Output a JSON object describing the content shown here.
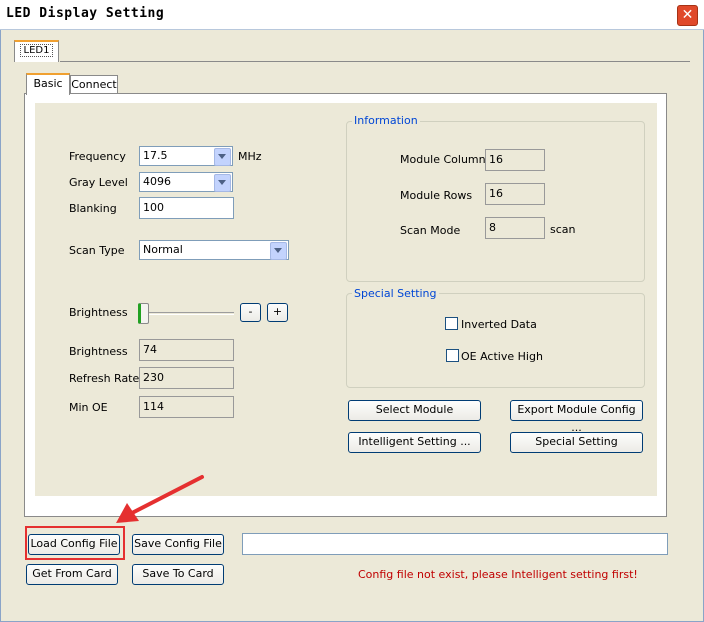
{
  "window": {
    "title": "LED Display Setting",
    "close_label": "✕"
  },
  "outer_tabs": [
    {
      "label": "LED1"
    }
  ],
  "inner_tabs": [
    {
      "label": "Basic"
    },
    {
      "label": "Connect"
    }
  ],
  "basic": {
    "frequency": {
      "label": "Frequency",
      "value": "17.5",
      "unit": "MHz"
    },
    "gray_level": {
      "label": "Gray Level",
      "value": "4096"
    },
    "blanking": {
      "label": "Blanking",
      "value": "100"
    },
    "scan_type": {
      "label": "Scan Type",
      "value": "Normal"
    },
    "brightness_slider": {
      "label": "Brightness",
      "level": 0,
      "minus_label": "-",
      "plus_label": "+"
    },
    "brightness": {
      "label": "Brightness",
      "value": "74"
    },
    "refresh_rate": {
      "label": "Refresh Rate",
      "value": "230"
    },
    "min_oe": {
      "label": "Min OE",
      "value": "114"
    }
  },
  "information": {
    "title": "Information",
    "module_columns": {
      "label": "Module Columns",
      "value": "16"
    },
    "module_rows": {
      "label": "Module Rows",
      "value": "16"
    },
    "scan_mode": {
      "label": "Scan Mode",
      "value": "8",
      "unit": "scan"
    }
  },
  "special_setting": {
    "title": "Special Setting",
    "inverted_data": {
      "label": "Inverted Data",
      "checked": false
    },
    "oe_active_high": {
      "label": "OE Active High",
      "checked": false
    }
  },
  "buttons": {
    "select_module": "Select Module",
    "export_module_config": "Export Module Config ...",
    "intelligent_setting": "Intelligent Setting ...",
    "special_setting": "Special Setting",
    "load_config_file": "Load Config File",
    "save_config_file": "Save Config File",
    "get_from_card": "Get From Card",
    "save_to_card": "Save To Card"
  },
  "path_field": {
    "value": ""
  },
  "status_message": "Config file not exist, please Intelligent setting first!",
  "colors": {
    "status_text": "#c00000",
    "group_title": "#0046d5",
    "annotation": "#e53030",
    "tab_accent": "#f0a030"
  }
}
